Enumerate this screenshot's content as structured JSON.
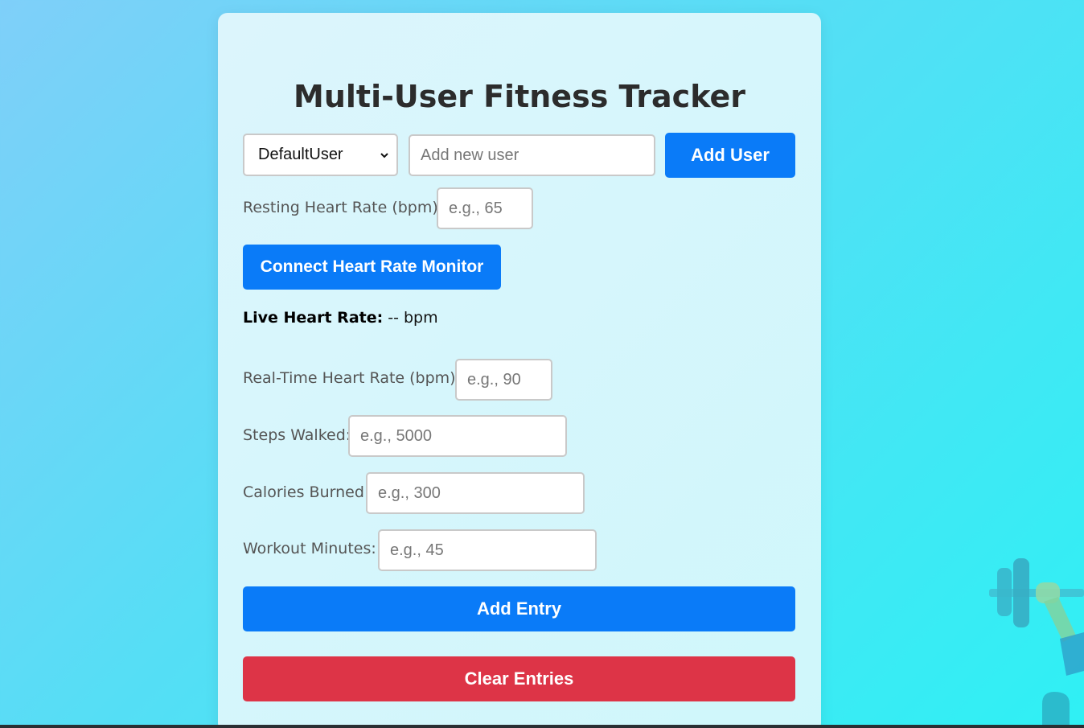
{
  "header": {
    "title": "Multi-User Fitness Tracker"
  },
  "users": {
    "selected": "DefaultUser",
    "new_user_placeholder": "Add new user",
    "add_user_label": "Add User"
  },
  "resting_hr": {
    "label": "Resting Heart Rate (bpm):",
    "placeholder": "e.g., 65"
  },
  "monitor": {
    "connect_label": "Connect Heart Rate Monitor",
    "live_label": "Live Heart Rate:",
    "live_value": "-- bpm"
  },
  "fields": [
    {
      "label": "Real-Time Heart Rate (bpm):",
      "placeholder": "e.g., 90"
    },
    {
      "label": "Steps Walked:",
      "placeholder": "e.g., 5000"
    },
    {
      "label": "Calories Burned:",
      "placeholder": "e.g., 300"
    },
    {
      "label": "Workout Minutes:",
      "placeholder": "e.g., 45"
    }
  ],
  "actions": {
    "add_entry_label": "Add Entry",
    "clear_entries_label": "Clear Entries"
  },
  "colors": {
    "primary": "#0a7bf8",
    "danger": "#dd3447"
  },
  "icons": {
    "select_chevron": "chevron-down-icon",
    "decoration": "dumbbell-icon"
  }
}
